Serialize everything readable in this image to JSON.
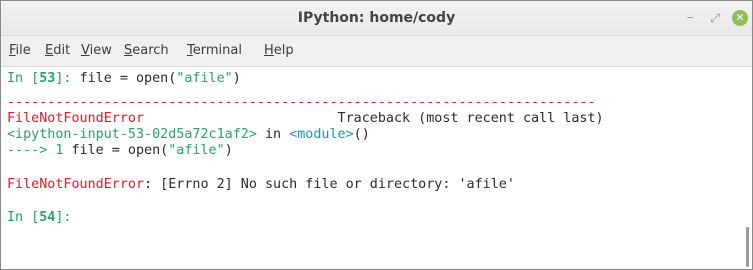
{
  "window": {
    "title": "IPython: home/cody",
    "minimize_glyph": "–",
    "maximize_glyph": "⤢",
    "close_glyph": "✕",
    "colors": {
      "close": "#8fbf5a"
    }
  },
  "menubar": {
    "items": [
      {
        "mnemonic": "F",
        "rest": "ile"
      },
      {
        "mnemonic": "E",
        "rest": "dit"
      },
      {
        "mnemonic": "V",
        "rest": "iew"
      },
      {
        "mnemonic": "S",
        "rest": "earch"
      },
      {
        "mnemonic": "T",
        "rest": "erminal"
      },
      {
        "mnemonic": "H",
        "rest": "elp"
      }
    ]
  },
  "terminal": {
    "colors": {
      "green": "#26a269",
      "red": "#e01b24",
      "cyan": "#2a8fb0"
    },
    "prompt1": {
      "prefix": "In [",
      "number": "53",
      "suffix": "]: ",
      "code_before": "file = open(",
      "string": "\"afile\"",
      "code_after": ")"
    },
    "separator": "-------------------------------------------------------------------------",
    "error_header": {
      "name": "FileNotFoundError",
      "gap": "                        ",
      "traceback": "Traceback (most recent call last)"
    },
    "input_location": {
      "source": "<ipython-input-53-02d5a72c1af2>",
      "in_word": " in ",
      "module": "<module>",
      "call": "()"
    },
    "arrow_line": {
      "arrow": "----> 1 ",
      "code_before": "file = open(",
      "string": "\"afile\"",
      "code_after": ")"
    },
    "error_message": {
      "name": "FileNotFoundError",
      "message": ": [Errno 2] No such file or directory: 'afile'"
    },
    "prompt2": {
      "prefix": "In [",
      "number": "54",
      "suffix": "]:"
    }
  }
}
